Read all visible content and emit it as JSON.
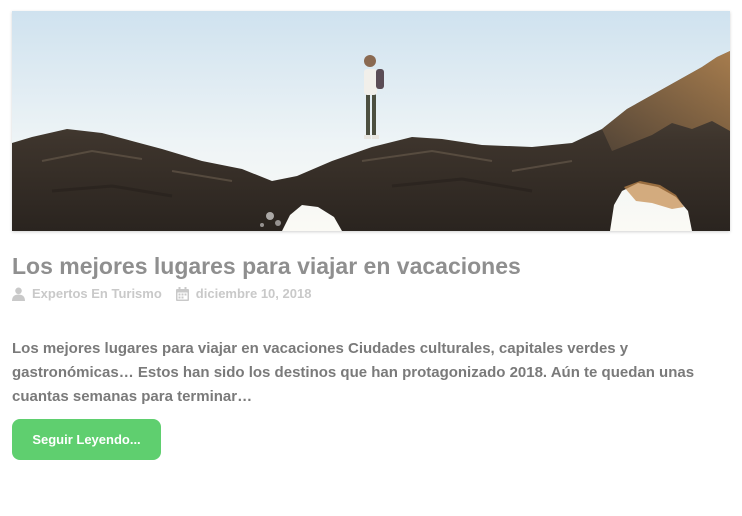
{
  "post": {
    "title": "Los mejores lugares para viajar en vacaciones",
    "author": "Expertos En Turismo",
    "date": "diciembre 10, 2018",
    "excerpt": "Los mejores lugares para viajar en vacaciones Ciudades culturales, capitales verdes y gastronómicas… Estos han sido los destinos que han protagonizado 2018. Aún te quedan unas cuantas semanas para terminar…",
    "read_more_label": "Seguir Leyendo...",
    "author_icon": "user-icon",
    "date_icon": "calendar-icon"
  },
  "colors": {
    "title": "#8f8f8f",
    "meta": "#c9c9c9",
    "excerpt": "#7a7a7a",
    "button": "#5fcf6f"
  }
}
